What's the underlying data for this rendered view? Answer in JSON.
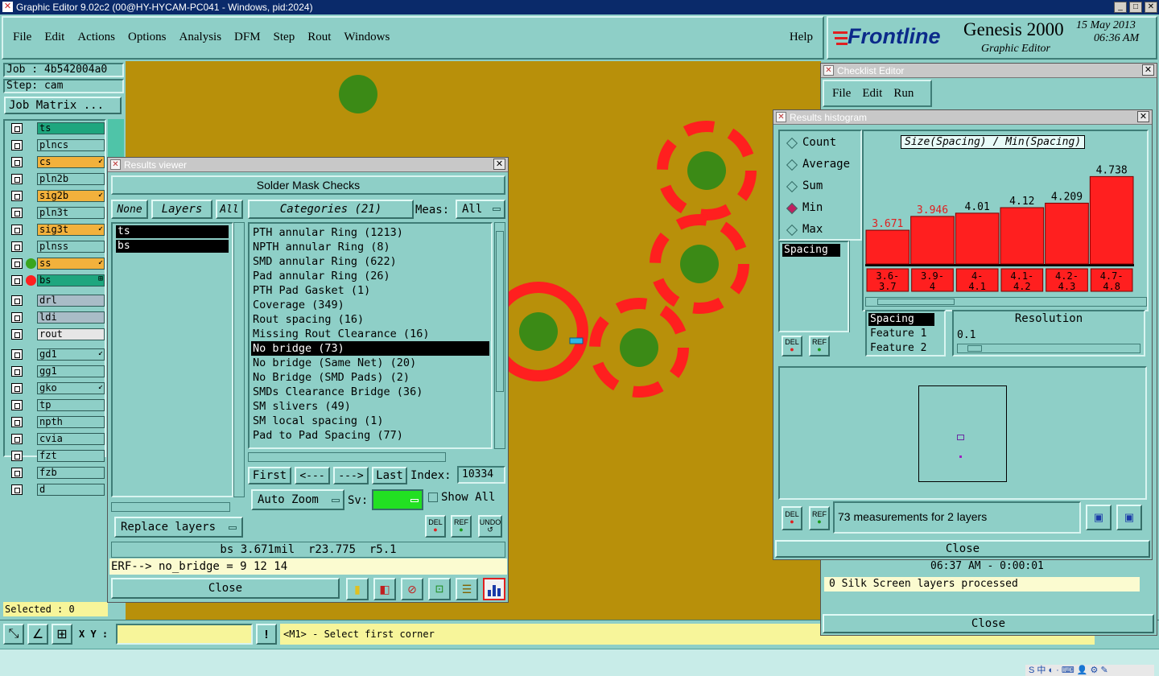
{
  "window_title": "Graphic Editor 9.02c2 (00@HY-HYCAM-PC041 - Windows, pid:2024)",
  "menu": [
    "File",
    "Edit",
    "Actions",
    "Options",
    "Analysis",
    "DFM",
    "Step",
    "Rout",
    "Windows"
  ],
  "help_label": "Help",
  "brand": {
    "logo": "Frontline",
    "product": "Genesis 2000",
    "subtitle": "Graphic Editor",
    "date": "15 May 2013",
    "time": "06:36 AM"
  },
  "job": {
    "job_text": "Job : 4b542004a0",
    "step_text": "Step: cam",
    "matrix_button": "Job Matrix ..."
  },
  "layers": [
    {
      "name": "ts",
      "color": "#1ea67e",
      "mark": ""
    },
    {
      "name": "plncs",
      "color": "#8ecfc7",
      "mark": ""
    },
    {
      "name": "cs",
      "color": "#f2b13c",
      "mark": "↙"
    },
    {
      "name": "pln2b",
      "color": "#8ecfc7",
      "mark": ""
    },
    {
      "name": "sig2b",
      "color": "#f2b13c",
      "mark": "↙"
    },
    {
      "name": "pln3t",
      "color": "#8ecfc7",
      "mark": ""
    },
    {
      "name": "sig3t",
      "color": "#f2b13c",
      "mark": "↙"
    },
    {
      "name": "plnss",
      "color": "#8ecfc7",
      "mark": ""
    },
    {
      "name": "ss",
      "color": "#f2b13c",
      "mark": "↙"
    },
    {
      "name": "bs",
      "color": "#1ea67e",
      "mark": "⊞"
    },
    {
      "name": "drl",
      "color": "#a9bcc7",
      "mark": ""
    },
    {
      "name": "ldi",
      "color": "#a9bcc7",
      "mark": ""
    },
    {
      "name": "rout",
      "color": "#e6e6e6",
      "mark": ""
    },
    {
      "name": "gd1",
      "color": "#8ecfc7",
      "mark": "↙"
    },
    {
      "name": "gg1",
      "color": "#8ecfc7",
      "mark": ""
    },
    {
      "name": "gko",
      "color": "#8ecfc7",
      "mark": "↙"
    },
    {
      "name": "tp",
      "color": "#8ecfc7",
      "mark": ""
    },
    {
      "name": "npth",
      "color": "#8ecfc7",
      "mark": ""
    },
    {
      "name": "cvia",
      "color": "#8ecfc7",
      "mark": ""
    },
    {
      "name": "fzt",
      "color": "#8ecfc7",
      "mark": ""
    },
    {
      "name": "fzb",
      "color": "#8ecfc7",
      "mark": ""
    },
    {
      "name": "d",
      "color": "#8ecfc7",
      "mark": ""
    }
  ],
  "selected_text": "Selected : 0",
  "xy_label": "X Y :",
  "status_prompt": "<M1> - Select first corner",
  "results_viewer": {
    "title": "Results viewer",
    "header": "Solder Mask Checks",
    "none_btn": "None",
    "layers_btn": "Layers",
    "all_btn": "All",
    "categories_btn": "Categories (21)",
    "meas_label": "Meas:",
    "meas_value": "All",
    "layer_list": [
      "ts",
      "bs"
    ],
    "categories": [
      "PTH annular Ring (1213)",
      "NPTH annular Ring (8)",
      "SMD annular Ring (622)",
      "Pad annular Ring (26)",
      "PTH Pad Gasket (1)",
      "Coverage (349)",
      "Rout spacing (16)",
      "Missing Rout Clearance (16)",
      "No bridge (73)",
      "No bridge (Same Net) (20)",
      "No Bridge (SMD Pads) (2)",
      "SMDs Clearance Bridge (36)",
      "SM slivers (49)",
      "SM local spacing (1)",
      "Pad to Pad Spacing (77)"
    ],
    "selected_index": 8,
    "first": "First",
    "prev": "<---",
    "next": "--->",
    "last": "Last",
    "index_label": "Index:",
    "index_value": "10334",
    "auto_zoom": "Auto Zoom",
    "sv_label": "Sv:",
    "show_all": "Show All",
    "replace_layers": "Replace layers",
    "del": "DEL",
    "ref": "REF",
    "undo": "UNDO",
    "measurement": "bs 3.671mil  r23.775  r5.1",
    "erf": "ERF--> no_bridge = 9 12 14",
    "close": "Close"
  },
  "checklist": {
    "title": "Checklist Editor",
    "menu": [
      "File",
      "Edit",
      "Run"
    ],
    "time_text": "06:37 AM - 0:00:01",
    "log_text": "0 Silk Screen layers processed",
    "close": "Close"
  },
  "histogram": {
    "title": "Results histogram",
    "modes": [
      "Count",
      "Average",
      "Sum",
      "Min",
      "Max"
    ],
    "selected_mode": "Min",
    "chart_title": "Size(Spacing) / Min(Spacing)",
    "measure_list": [
      "Spacing"
    ],
    "attrs": [
      "Spacing",
      "Feature 1",
      "Feature 2"
    ],
    "resolution_label": "Resolution",
    "resolution_value": "0.1",
    "summary": "73 measurements for 2 layers",
    "close": "Close",
    "del": "DEL",
    "ref": "REF"
  },
  "chart_data": {
    "type": "bar",
    "title": "Size(Spacing) / Min(Spacing)",
    "categories": [
      "3.6-\n3.7",
      "3.9-\n4",
      "4-\n4.1",
      "4.1-\n4.2",
      "4.2-\n4.3",
      "4.7-\n4.8"
    ],
    "values": [
      3.671,
      3.946,
      4.01,
      4.12,
      4.209,
      4.738
    ],
    "labels": [
      "3.671",
      "3.946",
      "4.01",
      "4.12",
      "4.209",
      "4.738"
    ],
    "label_colors": [
      "#e02020",
      "#e02020",
      "#000000",
      "#000000",
      "#000000",
      "#000000"
    ]
  }
}
